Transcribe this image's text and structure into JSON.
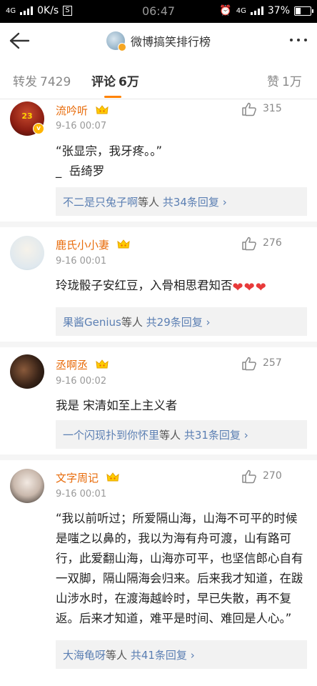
{
  "status_bar": {
    "network": "4G",
    "speed": "0K/s",
    "time": "06:47",
    "network_right": "4G",
    "battery": "37%"
  },
  "header": {
    "title": "微博搞笑排行榜"
  },
  "tabs": {
    "repost_label": "转发",
    "repost_count": "7429",
    "comment_label": "评论",
    "comment_count": "6万",
    "like_label": "赞",
    "like_count": "1万"
  },
  "comments": [
    {
      "username": "流吟听",
      "time": "9-16 00:07",
      "likes": "315",
      "text": "“张显宗，我牙疼。。”\n_  岳绮罗",
      "reply_user": "不二是只兔子啊",
      "reply_mid": "等人",
      "reply_count": "共34条回复",
      "avatar_text": "23"
    },
    {
      "username": "鹿氏小小妻",
      "time": "9-16 00:01",
      "likes": "276",
      "text": "玲珑骰子安红豆，入骨相思君知否",
      "reply_user": "果酱Genius",
      "reply_mid": "等人",
      "reply_count": "共29条回复"
    },
    {
      "username": "丞啊丞",
      "time": "9-16 00:02",
      "likes": "257",
      "text": "我是 宋清如至上主义者",
      "reply_user": "一个闪现扑到你怀里",
      "reply_mid": "等人",
      "reply_count": "共31条回复"
    },
    {
      "username": "文字周记",
      "time": "9-16 00:01",
      "likes": "270",
      "text": "“我以前听过；所爱隔山海，山海不可平的时候是嗤之以鼻的，我以为海有舟可渡，山有路可行，此爱翻山海，山海亦可平，也坚信郎心自有一双脚，隔山隔海会归来。后来我才知道，在跋山涉水时，在渡海越岭时，早已失散，再不复返。后来才知道，难平是时间、难回是人心。”",
      "reply_user": "大海龟呀",
      "reply_mid": "等人",
      "reply_count": "共41条回复"
    }
  ]
}
